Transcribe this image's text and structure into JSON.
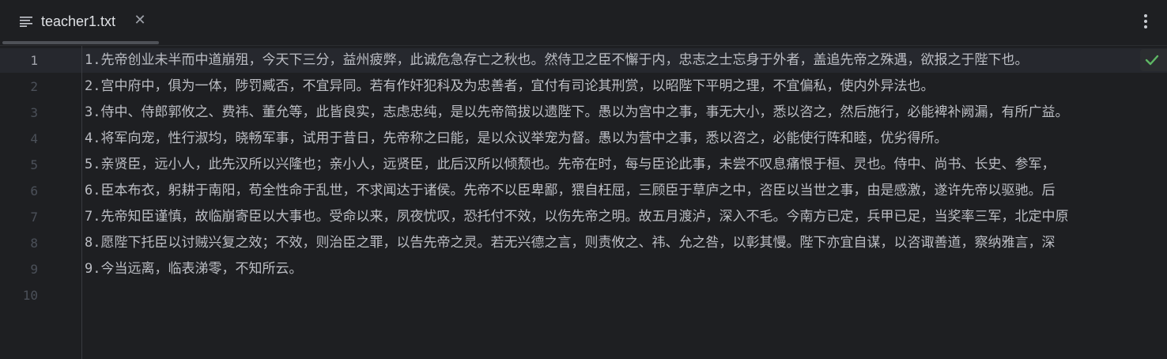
{
  "tab": {
    "title": "teacher1.txt",
    "file_icon": "text-file-icon",
    "close_icon": "close-icon"
  },
  "toolbar": {
    "more_icon": "more-vertical-icon"
  },
  "editor": {
    "current_line": 1,
    "line_numbers": [
      "1",
      "2",
      "3",
      "4",
      "5",
      "6",
      "7",
      "8",
      "9",
      "10"
    ],
    "lines": [
      "1.先帝创业未半而中道崩殂，今天下三分，益州疲弊，此诚危急存亡之秋也。然侍卫之臣不懈于内，忠志之士忘身于外者，盖追先帝之殊遇，欲报之于陛下也。",
      "2.宫中府中，俱为一体，陟罚臧否，不宜异同。若有作奸犯科及为忠善者，宜付有司论其刑赏，以昭陛下平明之理，不宜偏私，使内外异法也。",
      "3.侍中、侍郎郭攸之、费祎、董允等，此皆良实，志虑忠纯，是以先帝简拔以遗陛下。愚以为宫中之事，事无大小，悉以咨之，然后施行，必能裨补阙漏，有所广益。",
      "4.将军向宠，性行淑均，晓畅军事，试用于昔日，先帝称之曰能，是以众议举宠为督。愚以为营中之事，悉以咨之，必能使行阵和睦，优劣得所。",
      "5.亲贤臣，远小人，此先汉所以兴隆也；亲小人，远贤臣，此后汉所以倾颓也。先帝在时，每与臣论此事，未尝不叹息痛恨于桓、灵也。侍中、尚书、长史、参军，",
      "6.臣本布衣，躬耕于南阳，苟全性命于乱世，不求闻达于诸侯。先帝不以臣卑鄙，猥自枉屈，三顾臣于草庐之中，咨臣以当世之事，由是感激，遂许先帝以驱驰。后",
      "7.先帝知臣谨慎，故临崩寄臣以大事也。受命以来，夙夜忧叹，恐托付不效，以伤先帝之明。故五月渡泸，深入不毛。今南方已定，兵甲已足，当奖率三军，北定中原",
      "8.愿陛下托臣以讨贼兴复之效；不效，则治臣之罪，以告先帝之灵。若无兴德之言，则责攸之、祎、允之咎，以彰其慢。陛下亦宜自谋，以咨诹善道，察纳雅言，深",
      "9.今当远离，临表涕零，不知所云。",
      ""
    ],
    "inspection_icon": "checkmark-icon"
  },
  "colors": {
    "background": "#1e1f22",
    "text": "#bcbec4",
    "line_number": "#4b5059",
    "current_line_number": "#a1a3ab",
    "check": "#5fb865"
  }
}
